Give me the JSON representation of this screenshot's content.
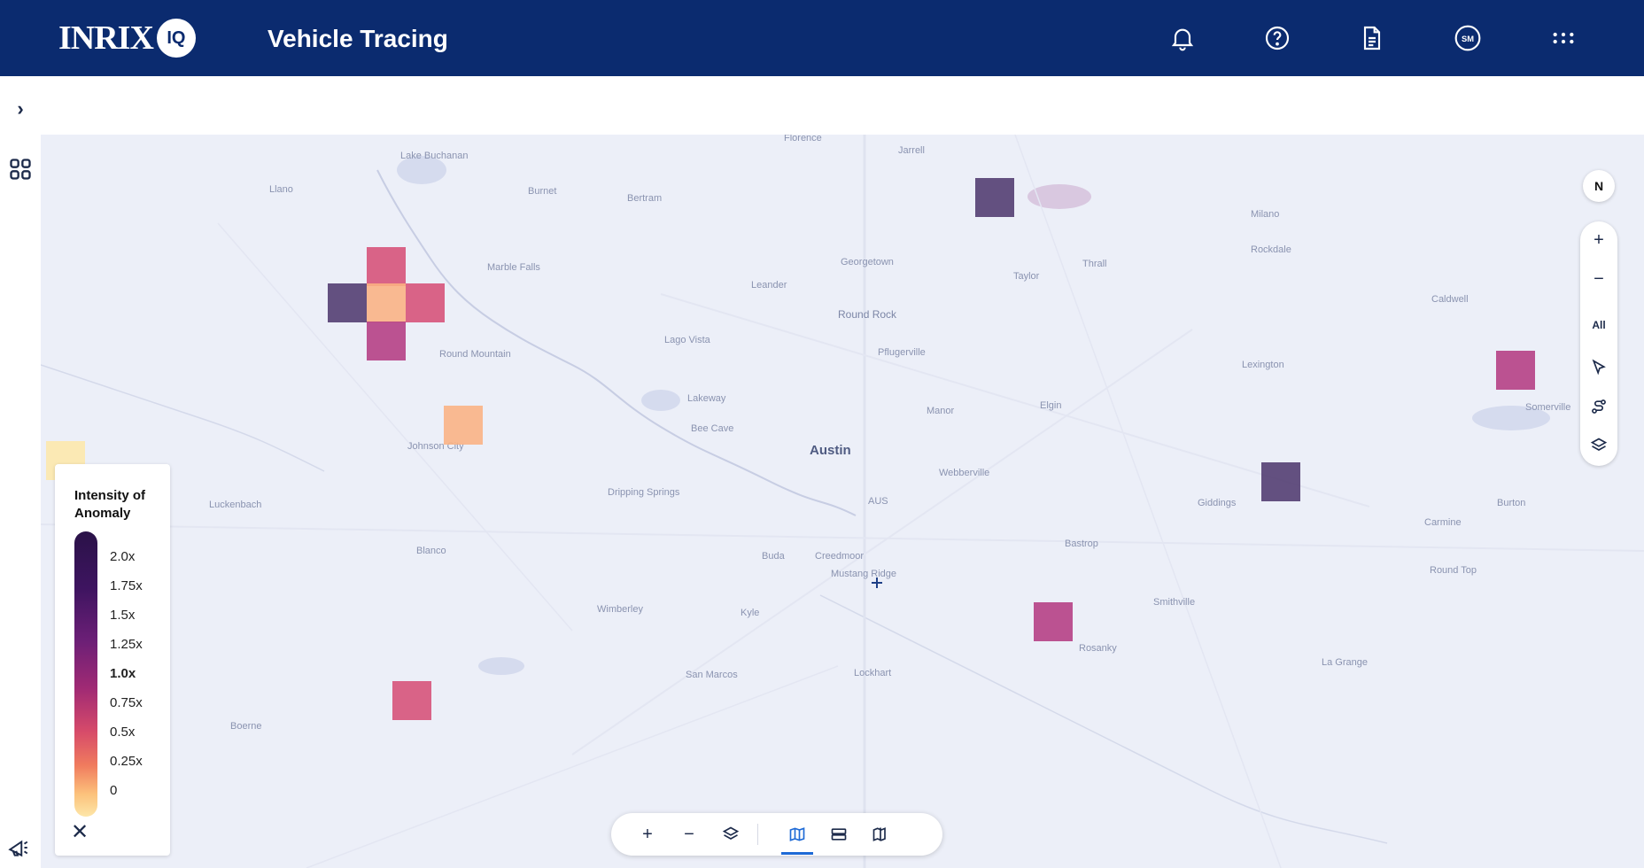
{
  "header": {
    "logo_text": "INRIX",
    "logo_badge": "IQ",
    "title": "Vehicle Tracing",
    "icons": [
      "bell-icon",
      "help-icon",
      "document-icon",
      "user-avatar-icon",
      "apps-grid-icon"
    ],
    "avatar_initials": "SM"
  },
  "rail": {
    "icons": [
      "chevron-right-icon",
      "apps-icon",
      "announcement-icon"
    ],
    "expand_glyph": "›"
  },
  "map": {
    "places": {
      "austin": "Austin",
      "round_rock": "Round Rock",
      "georgetown": "Georgetown",
      "pflugerville": "Pflugerville",
      "leander": "Leander",
      "taylor": "Taylor",
      "thrall": "Thrall",
      "manor": "Manor",
      "elgin": "Elgin",
      "bastrop": "Bastrop",
      "smithville": "Smithville",
      "lockhart": "Lockhart",
      "san_marcos": "San Marcos",
      "kyle": "Kyle",
      "buda": "Buda",
      "wimberley": "Wimberley",
      "dripping_springs": "Dripping Springs",
      "bee_cave": "Bee Cave",
      "lakeway": "Lakeway",
      "lago_vista": "Lago Vista",
      "johnson_city": "Johnson City",
      "round_mountain": "Round Mountain",
      "marble_falls": "Marble Falls",
      "burnet": "Burnet",
      "bertram": "Bertram",
      "florence": "Florence",
      "jarrell": "Jarrell",
      "blanco": "Blanco",
      "boerne": "Boerne",
      "luckenbach": "Luckenbach",
      "giddings": "Giddings",
      "lexington": "Lexington",
      "rockdale": "Rockdale",
      "caldwell": "Caldwell",
      "somerville": "Somerville",
      "la_grange": "La Grange",
      "webberville": "Webberville",
      "creedmoor": "Creedmoor",
      "mustang_ridge": "Mustang Ridge",
      "lake_buchanan": "Lake Buchanan",
      "llano": "Llano",
      "milano": "Milano",
      "rosanky": "Rosanky",
      "carmine": "Carmine",
      "burton": "Burton",
      "round_top": "Round Top",
      "aus": "AUS"
    }
  },
  "legend": {
    "title": "Intensity of Anomaly",
    "ticks": [
      "2.0x",
      "1.75x",
      "1.5x",
      "1.25x",
      "1.0x",
      "0.75x",
      "0.5x",
      "0.25x",
      "0"
    ],
    "close_glyph": "✕"
  },
  "heat_cells": [
    {
      "id": "cell-1",
      "intensity": 2.0
    },
    {
      "id": "cell-2",
      "intensity": 1.0
    },
    {
      "id": "cell-3",
      "intensity": 2.0
    },
    {
      "id": "cell-4",
      "intensity": 0.25
    },
    {
      "id": "cell-5",
      "intensity": 1.0
    },
    {
      "id": "cell-6",
      "intensity": 1.25
    },
    {
      "id": "cell-7",
      "intensity": 0.25
    },
    {
      "id": "cell-8",
      "intensity": 1.25
    },
    {
      "id": "cell-9",
      "intensity": 2.0
    },
    {
      "id": "cell-10",
      "intensity": 1.25
    },
    {
      "id": "cell-11",
      "intensity": 1.0
    },
    {
      "id": "cell-12",
      "intensity": 0.0
    }
  ],
  "map_controls": {
    "compass_label": "N",
    "zoom_in": "+",
    "zoom_out": "−",
    "all_label": "All"
  },
  "bottom_toolbar": {
    "zoom_in": "+",
    "zoom_out": "−"
  }
}
